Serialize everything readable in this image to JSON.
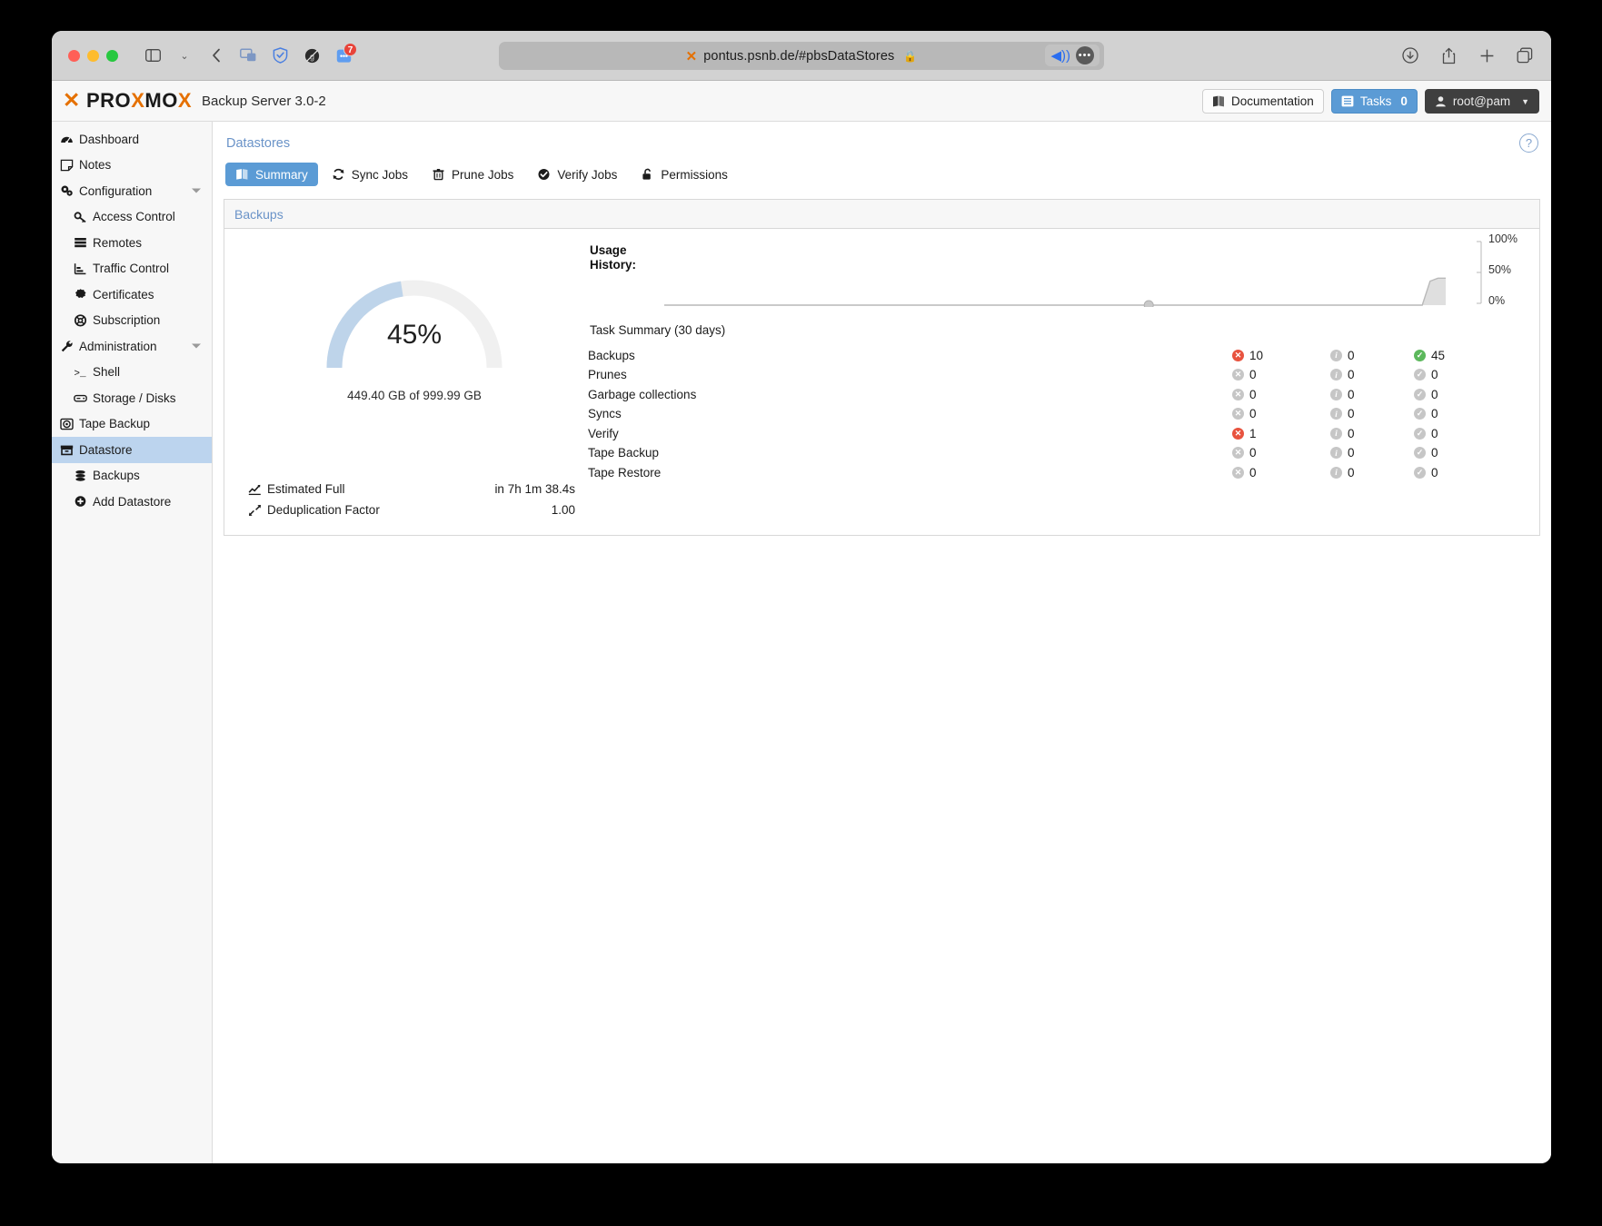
{
  "browser": {
    "url": "pontus.psnb.de/#pbsDataStores",
    "favicon": "proxmox-x-icon",
    "lock_icon": "lock-icon",
    "extension_badge": "7",
    "toolbar_icons": [
      "sidebar-icon",
      "chevron-down-icon",
      "back-icon",
      "tab-group-icon",
      "shield-icon",
      "ghostery-icon",
      "extension-icon"
    ],
    "right_icons": [
      "download-icon",
      "share-icon",
      "new-tab-icon",
      "tab-overview-icon"
    ],
    "url_right_icons": [
      "speaker-icon",
      "more-icon"
    ]
  },
  "header": {
    "logo": "PROXMOX",
    "logo_first_x": "X",
    "logo_mid": "PRO",
    "logo_mid_x": "X",
    "logo_end": "MO",
    "logo_last_x": "X",
    "product": "Backup Server 3.0-2",
    "documentation_label": "Documentation",
    "tasks_label": "Tasks",
    "tasks_count": "0",
    "user_label": "root@pam"
  },
  "sidebar": {
    "items": [
      {
        "label": "Dashboard",
        "icon": "dashboard-icon",
        "level": 0,
        "active": false,
        "caret": false
      },
      {
        "label": "Notes",
        "icon": "notes-icon",
        "level": 0,
        "active": false,
        "caret": false
      },
      {
        "label": "Configuration",
        "icon": "gears-icon",
        "level": 0,
        "active": false,
        "caret": true
      },
      {
        "label": "Access Control",
        "icon": "key-icon",
        "level": 1,
        "active": false,
        "caret": false
      },
      {
        "label": "Remotes",
        "icon": "server-icon",
        "level": 1,
        "active": false,
        "caret": false
      },
      {
        "label": "Traffic Control",
        "icon": "traffic-icon",
        "level": 1,
        "active": false,
        "caret": false
      },
      {
        "label": "Certificates",
        "icon": "certificate-icon",
        "level": 1,
        "active": false,
        "caret": false
      },
      {
        "label": "Subscription",
        "icon": "lifebuoy-icon",
        "level": 1,
        "active": false,
        "caret": false
      },
      {
        "label": "Administration",
        "icon": "wrench-icon",
        "level": 0,
        "active": false,
        "caret": true
      },
      {
        "label": "Shell",
        "icon": "terminal-icon",
        "level": 1,
        "active": false,
        "caret": false
      },
      {
        "label": "Storage / Disks",
        "icon": "disk-icon",
        "level": 1,
        "active": false,
        "caret": false
      },
      {
        "label": "Tape Backup",
        "icon": "tape-icon",
        "level": 0,
        "active": false,
        "caret": false
      },
      {
        "label": "Datastore",
        "icon": "datastore-icon",
        "level": 0,
        "active": true,
        "caret": false
      },
      {
        "label": "Backups",
        "icon": "database-icon",
        "level": 1,
        "active": false,
        "caret": false
      },
      {
        "label": "Add Datastore",
        "icon": "plus-circle-icon",
        "level": 1,
        "active": false,
        "caret": false
      }
    ]
  },
  "content": {
    "breadcrumb": "Datastores",
    "help_icon": "help-icon",
    "tabs": [
      {
        "label": "Summary",
        "icon": "book-icon",
        "active": true
      },
      {
        "label": "Sync Jobs",
        "icon": "sync-icon",
        "active": false
      },
      {
        "label": "Prune Jobs",
        "icon": "trash-icon",
        "active": false
      },
      {
        "label": "Verify Jobs",
        "icon": "check-circle-icon",
        "active": false
      },
      {
        "label": "Permissions",
        "icon": "unlock-icon",
        "active": false
      }
    ],
    "panel_title": "Backups",
    "gauge": {
      "percent_label": "45%",
      "percent_value": 45,
      "usage_text": "449.40 GB of 999.99 GB",
      "arc_color": "#bed4ea",
      "track_color": "#f0f0f0"
    },
    "stats": [
      {
        "icon": "chart-line-icon",
        "label": "Estimated Full",
        "value": "in 7h 1m 38.4s"
      },
      {
        "icon": "compress-icon",
        "label": "Deduplication Factor",
        "value": "1.00"
      }
    ],
    "usage_history_label_line1": "Usage",
    "usage_history_label_line2": "History:",
    "task_summary_title": "Task Summary (30 days)",
    "task_rows": [
      {
        "name": "Backups",
        "error": "10",
        "warning": "0",
        "ok": "45"
      },
      {
        "name": "Prunes",
        "error": "0",
        "warning": "0",
        "ok": "0"
      },
      {
        "name": "Garbage collections",
        "error": "0",
        "warning": "0",
        "ok": "0"
      },
      {
        "name": "Syncs",
        "error": "0",
        "warning": "0",
        "ok": "0"
      },
      {
        "name": "Verify",
        "error": "1",
        "warning": "0",
        "ok": "0"
      },
      {
        "name": "Tape Backup",
        "error": "0",
        "warning": "0",
        "ok": "0"
      },
      {
        "name": "Tape Restore",
        "error": "0",
        "warning": "0",
        "ok": "0"
      }
    ],
    "colors": {
      "error": "#e8533f",
      "zero": "#c6c6c6",
      "ok": "#5cb85c",
      "accent": "#5b9bd5",
      "link": "#6a93c8"
    }
  },
  "chart_data": {
    "type": "area",
    "title": "Usage History",
    "xlabel": "",
    "ylabel": "",
    "ylim": [
      0,
      100
    ],
    "tick_labels": [
      "100%",
      "50%",
      "0%"
    ],
    "ticks": [
      100,
      50,
      0
    ],
    "grid": false,
    "legend": "none",
    "series": [
      {
        "name": "Usage %",
        "x": [
          0,
          10,
          20,
          30,
          40,
          50,
          60,
          70,
          80,
          90,
          95,
          97,
          98,
          99,
          100
        ],
        "values": [
          0,
          0,
          0,
          0,
          0,
          0,
          0,
          0,
          0,
          0,
          0,
          0,
          40,
          45,
          45
        ]
      }
    ],
    "marker_points": [
      {
        "x": 62,
        "y": 0
      }
    ]
  }
}
